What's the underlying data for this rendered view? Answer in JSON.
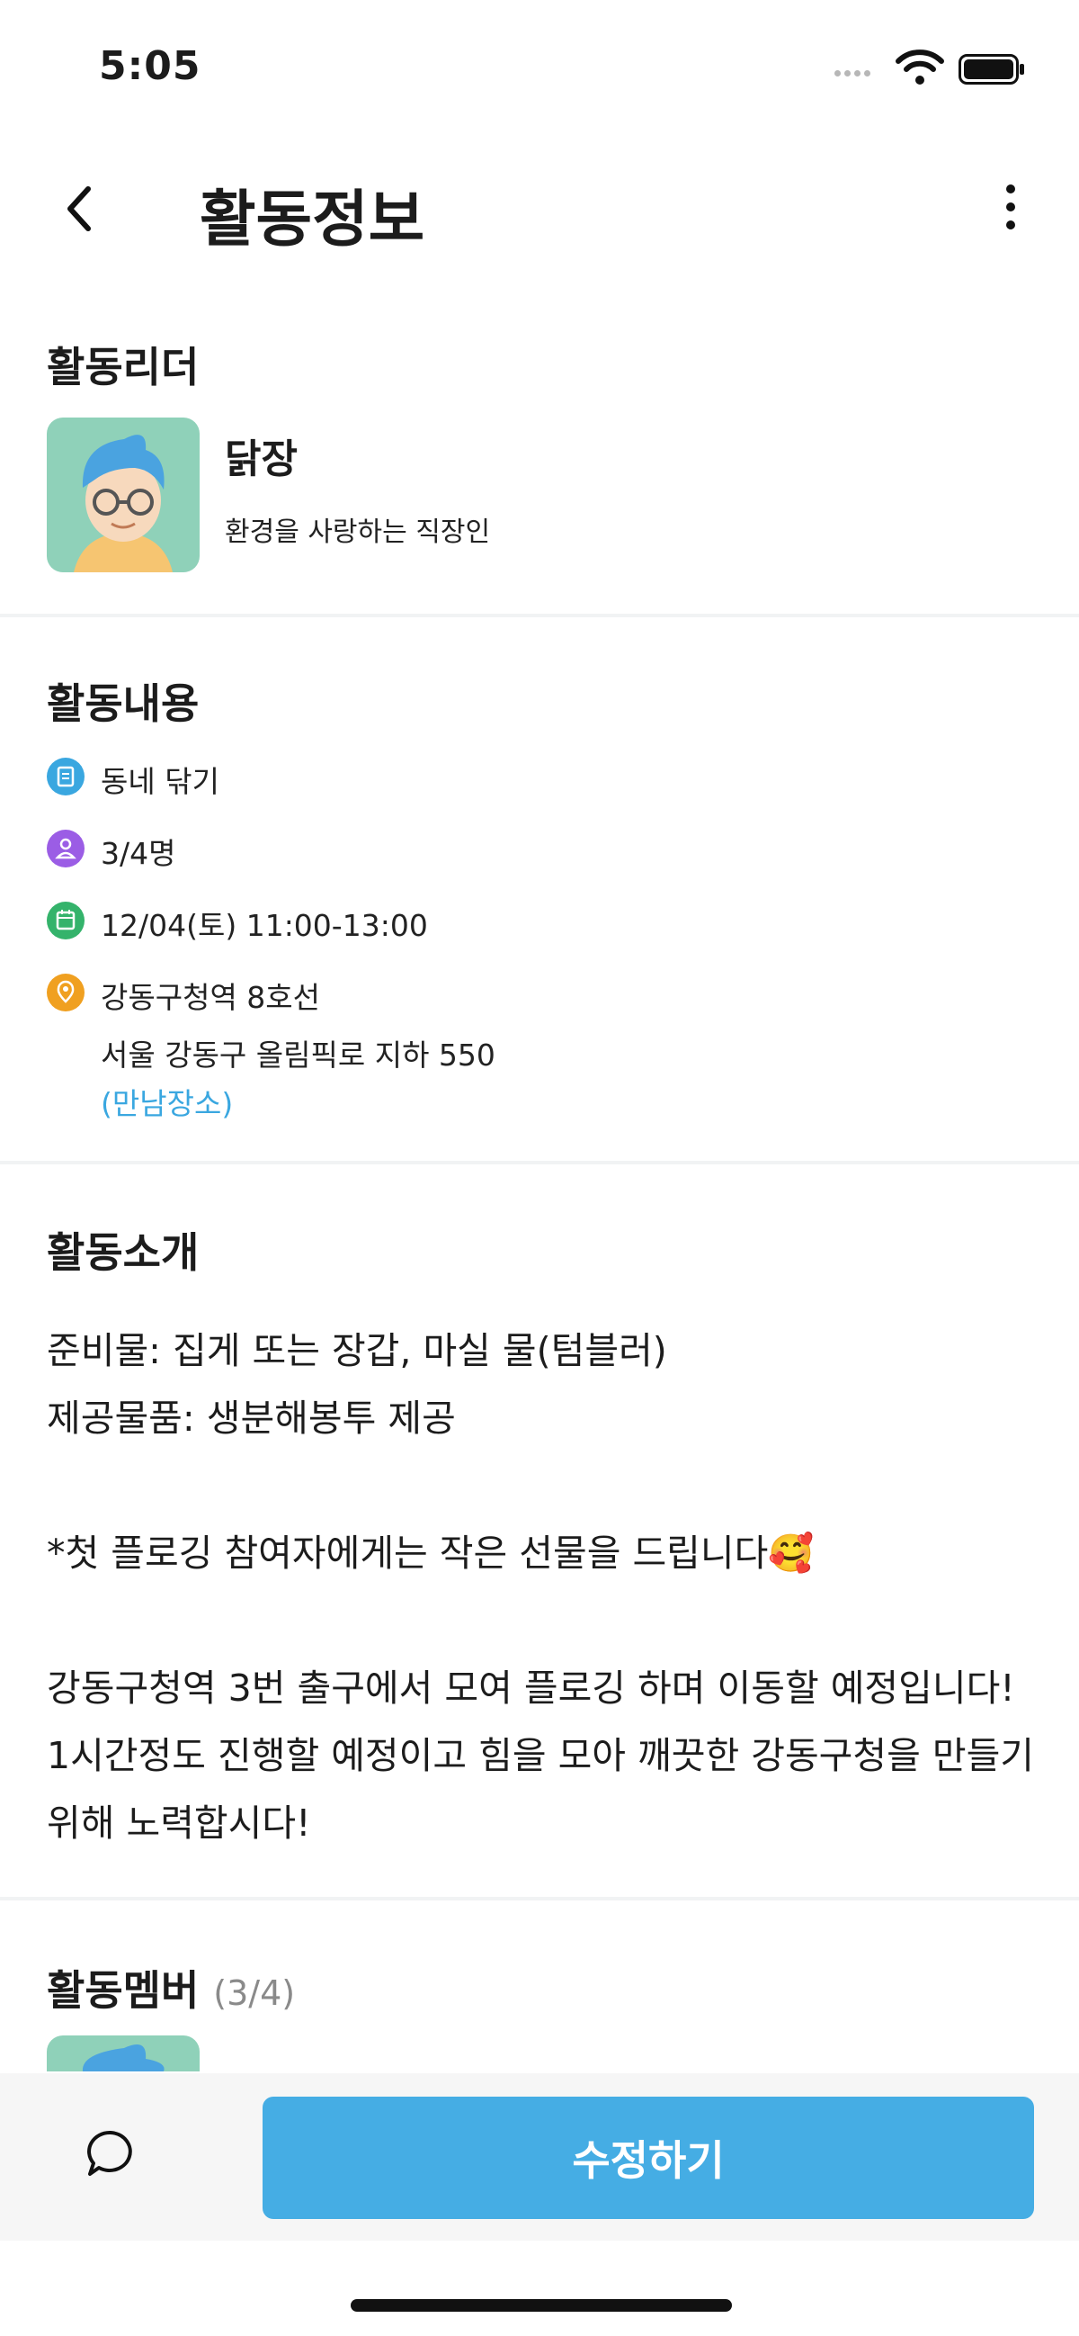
{
  "status_bar": {
    "time": "5:05"
  },
  "header": {
    "title": "활동정보"
  },
  "leader": {
    "section_title": "활동리더",
    "name": "닭장",
    "description": "환경을 사랑하는 직장인"
  },
  "details": {
    "section_title": "활동내용",
    "category": "동네 닦기",
    "participants": "3/4명",
    "datetime": "12/04(토) 11:00-13:00",
    "place": "강동구청역 8호선",
    "address": "서울 강동구 올림픽로 지하 550",
    "meeting_link": "(만남장소)",
    "icon_colors": {
      "category": "#3aa7e0",
      "participants": "#9b5de5",
      "datetime": "#34b36b",
      "place": "#f0a020"
    }
  },
  "intro": {
    "section_title": "활동소개",
    "text": "준비물: 집게 또는 장갑, 마실 물(텀블러)\n제공물품: 생분해봉투 제공\n\n*첫 플로깅 참여자에게는 작은 선물을 드립니다🥰\n\n강동구청역 3번 출구에서 모여 플로깅 하며 이동할 예정입니다! 1시간정도 진행할 예정이고 힘을 모아 깨끗한 강동구청을 만들기 위해 노력합시다!"
  },
  "members": {
    "section_title": "활동멤버",
    "count": "(3/4)"
  },
  "bottom_bar": {
    "edit_label": "수정하기"
  },
  "colors": {
    "accent": "#45ade4",
    "avatar_bg": "#8fd1b9"
  }
}
